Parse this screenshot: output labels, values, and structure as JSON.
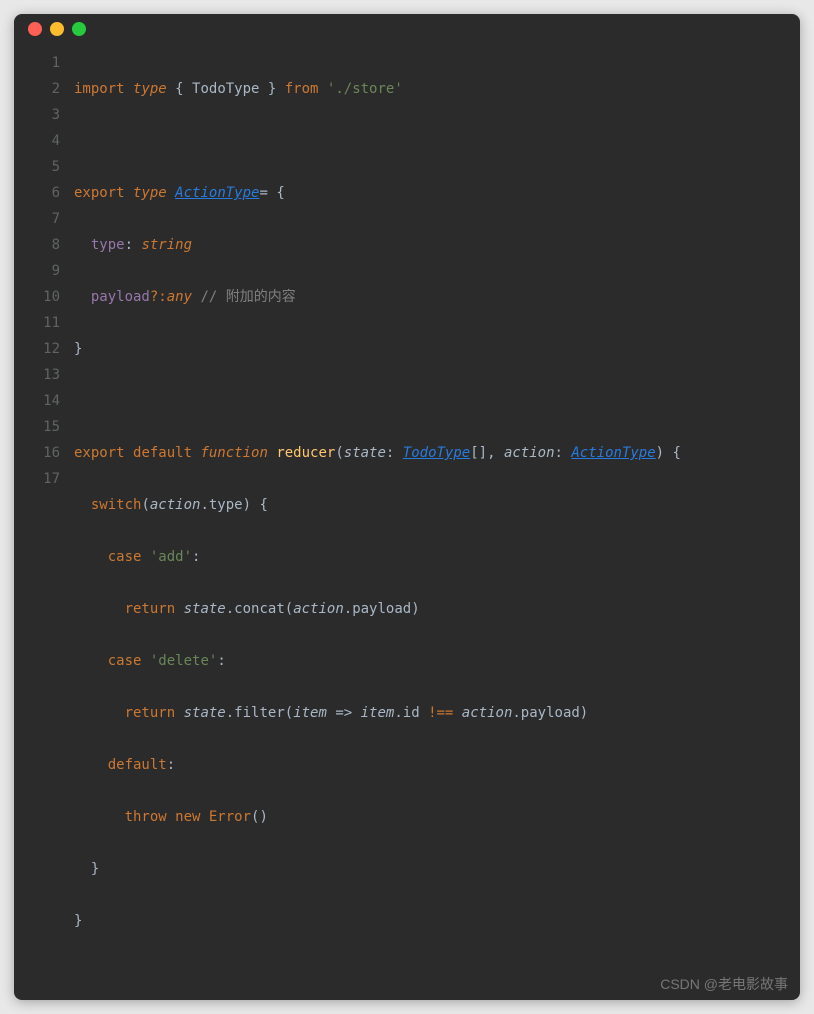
{
  "window": {
    "traffic": [
      "red",
      "yellow",
      "green"
    ]
  },
  "watermark": "CSDN @老电影故事",
  "lines": {
    "count": 17
  },
  "code": {
    "l1": {
      "a": "import",
      "b": "type",
      "c": "{ ",
      "d": "TodoType",
      "e": " }",
      "f": " from ",
      "g": "'./store'"
    },
    "l3": {
      "a": "export ",
      "b": "type ",
      "c": "ActionType",
      "d": "= {"
    },
    "l4": {
      "a": "type",
      "b": ": ",
      "c": "string"
    },
    "l5": {
      "a": "payload",
      "b": "?:",
      "c": "any",
      "d": " // 附加的内容"
    },
    "l6": {
      "a": "}"
    },
    "l8": {
      "a": "export ",
      "b": "default ",
      "c": "function ",
      "d": "reducer",
      "e": "(",
      "f": "state",
      "g": ": ",
      "h": "TodoType",
      "i": "[], ",
      "j": "action",
      "k": ": ",
      "l": "ActionType",
      "m": ") {"
    },
    "l9": {
      "a": "switch",
      "b": "(",
      "c": "action",
      "d": ".type) {"
    },
    "l10": {
      "a": "case ",
      "b": "'add'",
      "c": ":"
    },
    "l11": {
      "a": "return ",
      "b": "state",
      "c": ".concat(",
      "d": "action",
      "e": ".payload)"
    },
    "l12": {
      "a": "case ",
      "b": "'delete'",
      "c": ":"
    },
    "l13": {
      "a": "return ",
      "b": "state",
      "c": ".filter(",
      "d": "item",
      "e": " => ",
      "f": "item",
      "g": ".id ",
      "h": "!==",
      "i": " ",
      "j": "action",
      "k": ".payload)"
    },
    "l14": {
      "a": "default",
      "b": ":"
    },
    "l15": {
      "a": "throw ",
      "b": "new ",
      "c": "Error",
      "d": "()"
    },
    "l16": {
      "a": "}"
    },
    "l17": {
      "a": "}"
    }
  },
  "gutter": [
    "1",
    "2",
    "3",
    "4",
    "5",
    "6",
    "7",
    "8",
    "9",
    "10",
    "11",
    "12",
    "13",
    "14",
    "15",
    "16",
    "17"
  ]
}
